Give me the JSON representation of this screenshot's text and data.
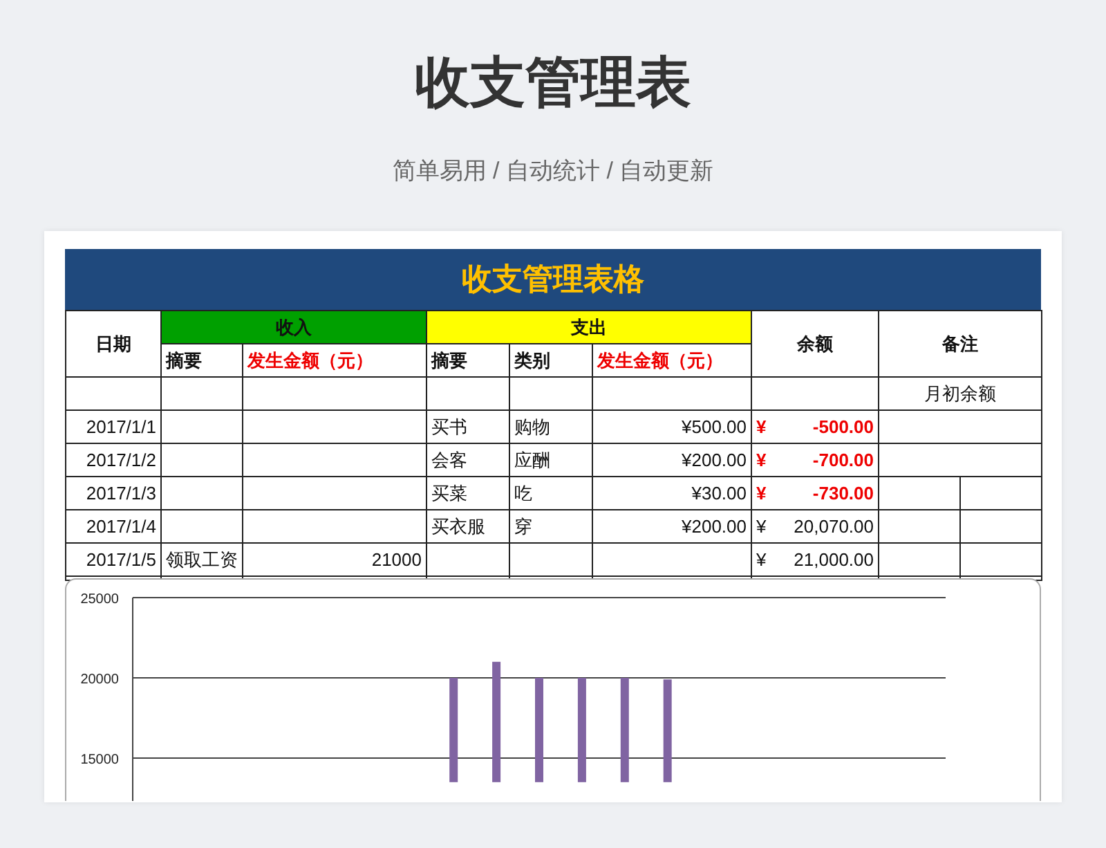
{
  "page": {
    "title": "收支管理表",
    "subtitle": "简单易用 / 自动统计 / 自动更新"
  },
  "sheet": {
    "title": "收支管理表格",
    "columns": {
      "date": "日期",
      "income": "收入",
      "expense": "支出",
      "balance": "余额",
      "note": "备注"
    },
    "sub_columns": [
      {
        "label": "摘要",
        "kind": "text"
      },
      {
        "label": "发生金额（元）",
        "kind": "amount"
      },
      {
        "label": "摘要",
        "kind": "text"
      },
      {
        "label": "类别",
        "kind": "text"
      },
      {
        "label": "发生金额（元）",
        "kind": "amount"
      }
    ],
    "rows": [
      {
        "date": "",
        "income_desc": "",
        "income_amount": "",
        "expense_desc": "",
        "expense_category": "",
        "expense_amount": "",
        "balance_currency": "",
        "balance": "",
        "note": "月初余额",
        "note_split": false
      },
      {
        "date": "2017/1/1",
        "income_desc": "",
        "income_amount": "",
        "expense_desc": "买书",
        "expense_category": "购物",
        "expense_amount": "¥500.00",
        "balance_currency": "¥",
        "balance": "-500.00",
        "negative": true,
        "note": "",
        "note_split": false
      },
      {
        "date": "2017/1/2",
        "income_desc": "",
        "income_amount": "",
        "expense_desc": "会客",
        "expense_category": "应酬",
        "expense_amount": "¥200.00",
        "balance_currency": "¥",
        "balance": "-700.00",
        "negative": true,
        "note": "",
        "note_split": false
      },
      {
        "date": "2017/1/3",
        "income_desc": "",
        "income_amount": "",
        "expense_desc": "买菜",
        "expense_category": "吃",
        "expense_amount": "¥30.00",
        "balance_currency": "¥",
        "balance": "-730.00",
        "negative": true,
        "note": "",
        "note_split": true
      },
      {
        "date": "2017/1/4",
        "income_desc": "",
        "income_amount": "",
        "expense_desc": "买衣服",
        "expense_category": "穿",
        "expense_amount": "¥200.00",
        "balance_currency": "¥",
        "balance": "20,070.00",
        "negative": false,
        "note": "",
        "note_split": true
      },
      {
        "date": "2017/1/5",
        "income_desc": "领取工资",
        "income_amount": "21000",
        "expense_desc": "",
        "expense_category": "",
        "expense_amount": "",
        "balance_currency": "¥",
        "balance": "21,000.00",
        "negative": false,
        "note": "",
        "note_split": true
      }
    ],
    "chart_data": {
      "type": "bar",
      "ylim": [
        13500,
        25000
      ],
      "yticks": [
        15000,
        20000,
        25000
      ],
      "series": [
        {
          "color": "#8064a2",
          "values": [
            null,
            null,
            null,
            null,
            null,
            null,
            null,
            20000,
            21000,
            20000,
            20000,
            20000,
            19900,
            null,
            null,
            null,
            null,
            null,
            null
          ]
        }
      ]
    }
  }
}
